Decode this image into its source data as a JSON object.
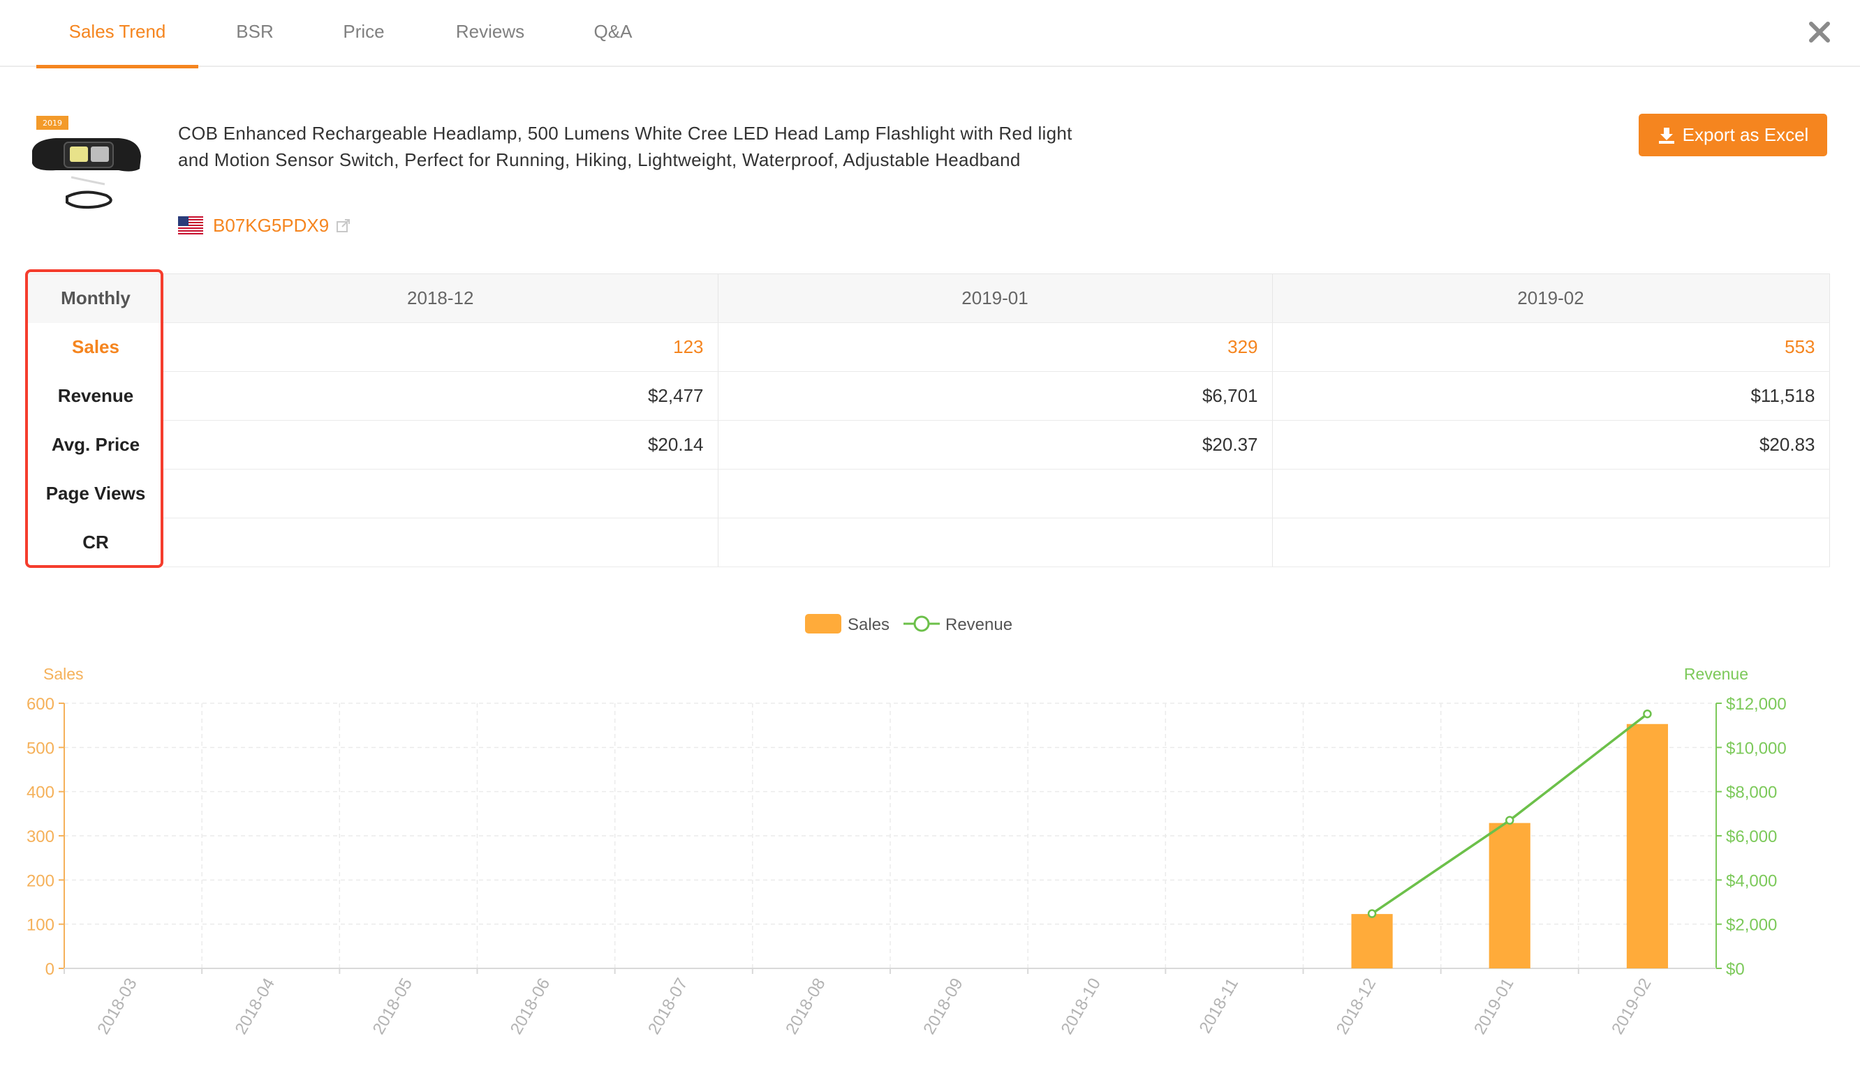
{
  "tabs": [
    {
      "label": "Sales Trend",
      "active": true
    },
    {
      "label": "BSR",
      "active": false
    },
    {
      "label": "Price",
      "active": false
    },
    {
      "label": "Reviews",
      "active": false
    },
    {
      "label": "Q&A",
      "active": false
    }
  ],
  "product": {
    "badge_year": "2019",
    "title": "COB Enhanced Rechargeable Headlamp, 500 Lumens White Cree LED Head Lamp Flashlight with Red light and Motion Sensor Switch, Perfect for Running, Hiking, Lightweight, Waterproof, Adjustable Headband",
    "asin": "B07KG5PDX9",
    "marketplace_flag": "us-flag-icon"
  },
  "export_button": {
    "label": "Export as Excel",
    "icon": "download-icon"
  },
  "table": {
    "header_label": "Monthly",
    "months": [
      "2018-12",
      "2019-01",
      "2019-02"
    ],
    "rows": [
      {
        "label": "Sales",
        "values": [
          "123",
          "329",
          "553"
        ]
      },
      {
        "label": "Revenue",
        "values": [
          "$2,477",
          "$6,701",
          "$11,518"
        ]
      },
      {
        "label": "Avg. Price",
        "values": [
          "$20.14",
          "$20.37",
          "$20.83"
        ]
      },
      {
        "label": "Page Views",
        "values": [
          "",
          "",
          ""
        ]
      },
      {
        "label": "CR",
        "values": [
          "",
          "",
          ""
        ]
      }
    ]
  },
  "colors": {
    "accent": "#f5851f",
    "sales_bar": "#ffab3a",
    "revenue_line": "#6cc04a",
    "highlight": "#f53d2d"
  },
  "chart_data": {
    "type": "bar",
    "legend": [
      "Sales",
      "Revenue"
    ],
    "categories": [
      "2018-03",
      "2018-04",
      "2018-05",
      "2018-06",
      "2018-07",
      "2018-08",
      "2018-09",
      "2018-10",
      "2018-11",
      "2018-12",
      "2019-01",
      "2019-02"
    ],
    "series": [
      {
        "name": "Sales",
        "type": "bar",
        "axis": "left",
        "values": [
          null,
          null,
          null,
          null,
          null,
          null,
          null,
          null,
          null,
          123,
          329,
          553
        ]
      },
      {
        "name": "Revenue",
        "type": "line",
        "axis": "right",
        "values": [
          null,
          null,
          null,
          null,
          null,
          null,
          null,
          null,
          null,
          2477,
          6701,
          11518
        ]
      }
    ],
    "left_axis": {
      "label": "Sales",
      "ylim": [
        0,
        600
      ],
      "ticks": [
        "0",
        "100",
        "200",
        "300",
        "400",
        "500",
        "600"
      ]
    },
    "right_axis": {
      "label": "Revenue",
      "ylim": [
        0,
        12000
      ],
      "ticks": [
        "$0",
        "$2,000",
        "$4,000",
        "$6,000",
        "$8,000",
        "$10,000",
        "$12,000"
      ]
    },
    "grid": true,
    "legend_position": "top-center"
  }
}
